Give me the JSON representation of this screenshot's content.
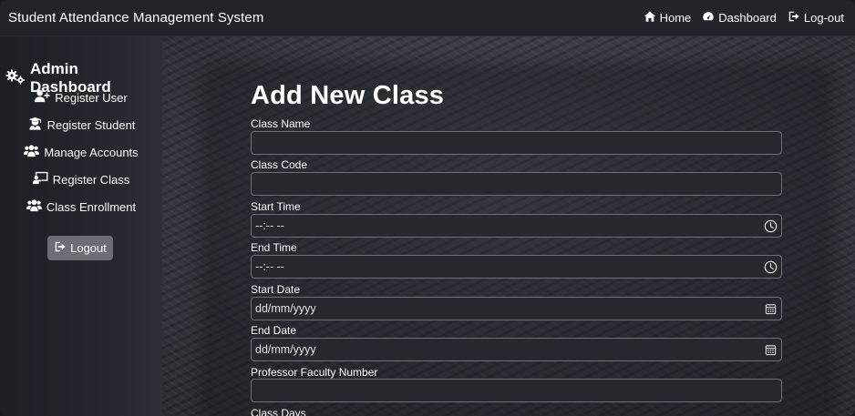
{
  "navbar": {
    "brand": "Student Attendance Management System",
    "links": [
      {
        "label": "Home",
        "icon": "home-icon"
      },
      {
        "label": "Dashboard",
        "icon": "gauge-icon"
      },
      {
        "label": "Log-out",
        "icon": "sign-out-icon"
      }
    ]
  },
  "sidebar": {
    "title": "Admin Dashboard",
    "title_icon": "gears-icon",
    "items": [
      {
        "label": "Register User",
        "icon": "user-plus-icon"
      },
      {
        "label": "Register Student",
        "icon": "user-graduate-icon"
      },
      {
        "label": "Manage Accounts",
        "icon": "users-icon"
      },
      {
        "label": "Register Class",
        "icon": "chalkboard-icon"
      },
      {
        "label": "Class Enrollment",
        "icon": "users-icon"
      }
    ],
    "logout_label": "Logout"
  },
  "form": {
    "title": "Add New Class",
    "fields": [
      {
        "label": "Class Name",
        "value": "",
        "type": "text"
      },
      {
        "label": "Class Code",
        "value": "",
        "type": "text"
      },
      {
        "label": "Start Time",
        "value": "--:-- --",
        "type": "time",
        "icon": "clock-icon"
      },
      {
        "label": "End Time",
        "value": "--:-- --",
        "type": "time",
        "icon": "clock-icon"
      },
      {
        "label": "Start Date",
        "value": "dd/mm/yyyy",
        "type": "date",
        "icon": "calendar-icon"
      },
      {
        "label": "End Date",
        "value": "dd/mm/yyyy",
        "type": "date",
        "icon": "calendar-icon"
      },
      {
        "label": "Professor Faculty Number",
        "value": "",
        "type": "text"
      }
    ],
    "next_label": "Class Days"
  }
}
